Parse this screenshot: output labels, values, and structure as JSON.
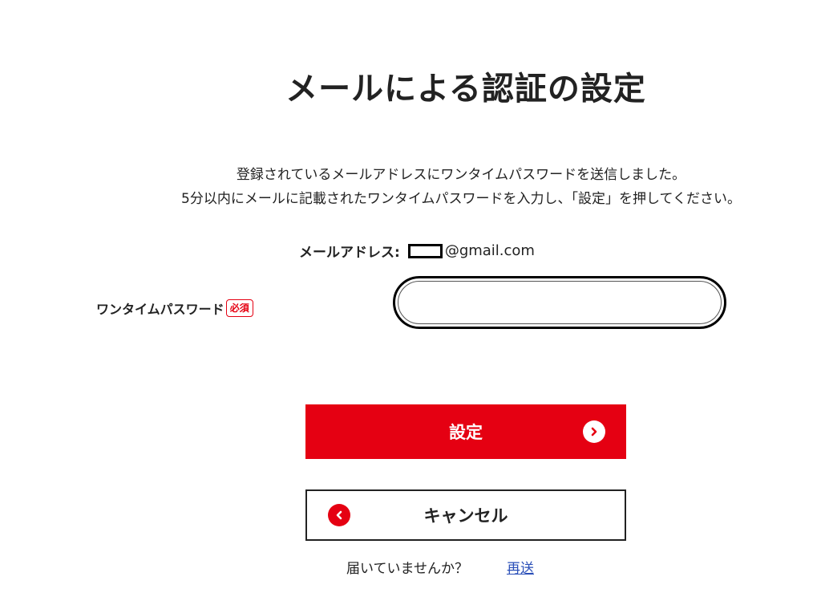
{
  "page": {
    "title": "メールによる認証の設定",
    "description_line1": "登録されているメールアドレスにワンタイムパスワードを送信しました。",
    "description_line2": "5分以内にメールに記載されたワンタイムパスワードを入力し、「設定」を押してください。"
  },
  "email": {
    "label": "メールアドレス:",
    "domain": "@gmail.com"
  },
  "password": {
    "label": "ワンタイムパスワード",
    "required_badge": "必須",
    "value": "",
    "placeholder": ""
  },
  "actions": {
    "submit_label": "設定",
    "submit_icon": "chevron-right-icon",
    "cancel_label": "キャンセル",
    "cancel_icon": "chevron-left-icon"
  },
  "resend": {
    "prompt": "届いていませんか？",
    "link_label": "再送"
  },
  "colors": {
    "accent": "#e50012",
    "text": "#222222",
    "link": "#2a4fb8"
  }
}
